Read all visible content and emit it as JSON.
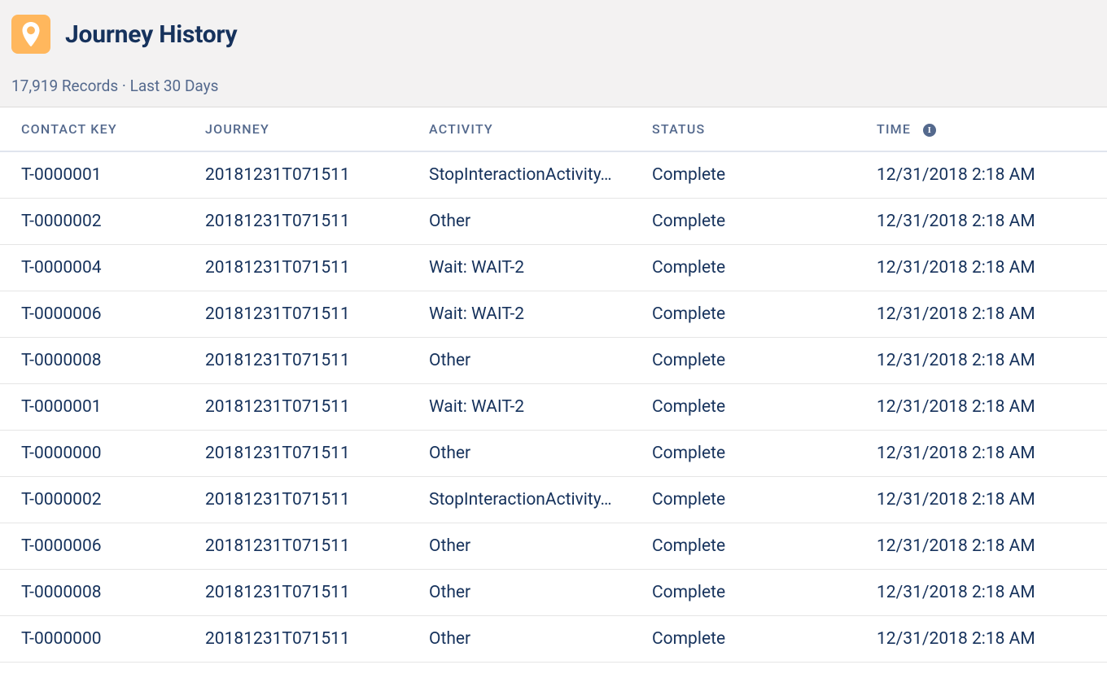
{
  "header": {
    "title": "Journey History",
    "records_meta": "17,919 Records · Last 30 Days"
  },
  "table": {
    "columns": {
      "contact_key": "Contact Key",
      "journey": "Journey",
      "activity": "Activity",
      "status": "Status",
      "time": "Time"
    },
    "rows": [
      {
        "contact_key": "T-0000001",
        "journey": "20181231T071511",
        "activity": "StopInteractionActivity…",
        "status": "Complete",
        "time": "12/31/2018 2:18 AM"
      },
      {
        "contact_key": "T-0000002",
        "journey": "20181231T071511",
        "activity": "Other",
        "status": "Complete",
        "time": "12/31/2018 2:18 AM"
      },
      {
        "contact_key": "T-0000004",
        "journey": "20181231T071511",
        "activity": "Wait: WAIT-2",
        "status": "Complete",
        "time": "12/31/2018 2:18 AM"
      },
      {
        "contact_key": "T-0000006",
        "journey": "20181231T071511",
        "activity": "Wait: WAIT-2",
        "status": "Complete",
        "time": "12/31/2018 2:18 AM"
      },
      {
        "contact_key": "T-0000008",
        "journey": "20181231T071511",
        "activity": "Other",
        "status": "Complete",
        "time": "12/31/2018 2:18 AM"
      },
      {
        "contact_key": "T-0000001",
        "journey": "20181231T071511",
        "activity": "Wait: WAIT-2",
        "status": "Complete",
        "time": "12/31/2018 2:18 AM"
      },
      {
        "contact_key": "T-0000000",
        "journey": "20181231T071511",
        "activity": "Other",
        "status": "Complete",
        "time": "12/31/2018 2:18 AM"
      },
      {
        "contact_key": "T-0000002",
        "journey": "20181231T071511",
        "activity": "StopInteractionActivity…",
        "status": "Complete",
        "time": "12/31/2018 2:18 AM"
      },
      {
        "contact_key": "T-0000006",
        "journey": "20181231T071511",
        "activity": "Other",
        "status": "Complete",
        "time": "12/31/2018 2:18 AM"
      },
      {
        "contact_key": "T-0000008",
        "journey": "20181231T071511",
        "activity": "Other",
        "status": "Complete",
        "time": "12/31/2018 2:18 AM"
      },
      {
        "contact_key": "T-0000000",
        "journey": "20181231T071511",
        "activity": "Other",
        "status": "Complete",
        "time": "12/31/2018 2:18 AM"
      }
    ]
  }
}
